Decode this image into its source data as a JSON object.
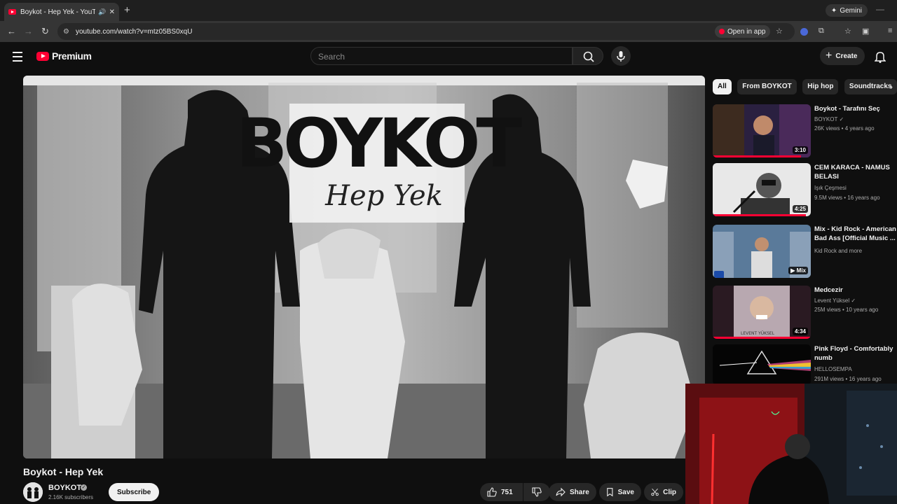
{
  "browser": {
    "tab_title": "Boykot - Hep Yek - YouTube",
    "url": "youtube.com/watch?v=mtz05BS0xqU",
    "gemini_label": "Gemini",
    "open_in_app_label": "Open in app"
  },
  "header": {
    "logo_text": "Premium",
    "search_placeholder": "Search",
    "create_label": "Create"
  },
  "video": {
    "overlay_title": "BOYKOT",
    "overlay_subtitle": "Hep Yek",
    "title": "Boykot - Hep Yek",
    "channel": "BOYKOT",
    "subscribers": "2.16K subscribers",
    "subscribe_label": "Subscribe",
    "likes": "751",
    "share_label": "Share",
    "save_label": "Save",
    "clip_label": "Clip"
  },
  "chips": [
    "All",
    "From BOYKOT",
    "Hip hop",
    "Soundtracks"
  ],
  "recommendations": [
    {
      "title": "Boykot - Tarafını Seç",
      "channel": "BOYKOT",
      "verified": true,
      "meta": "26K views • 4 years ago",
      "duration": "3:10",
      "progress": 0.9
    },
    {
      "title": "CEM KARACA - NAMUS BELASI",
      "channel": "Işık Çeşmesi",
      "verified": false,
      "meta": "9.5M views • 16 years ago",
      "duration": "4:25",
      "progress": 0.95
    },
    {
      "title": "Mix - Kid Rock - American Bad Ass [Official Music ...",
      "channel": "Kid Rock and more",
      "verified": false,
      "meta": "",
      "duration": "Mix",
      "progress": 0
    },
    {
      "title": "Medcezir",
      "channel": "Levent Yüksel",
      "verified": true,
      "meta": "25M views • 10 years ago",
      "duration": "4:34",
      "progress": 1.0
    },
    {
      "title": "Pink Floyd - Comfortably numb",
      "channel": "HELLOSEMPA",
      "verified": false,
      "meta": "291M views • 16 years ago",
      "duration": "",
      "progress": 0
    }
  ],
  "thumb_labels": {
    "medcezir": "LEVENT YÜKSEL"
  }
}
